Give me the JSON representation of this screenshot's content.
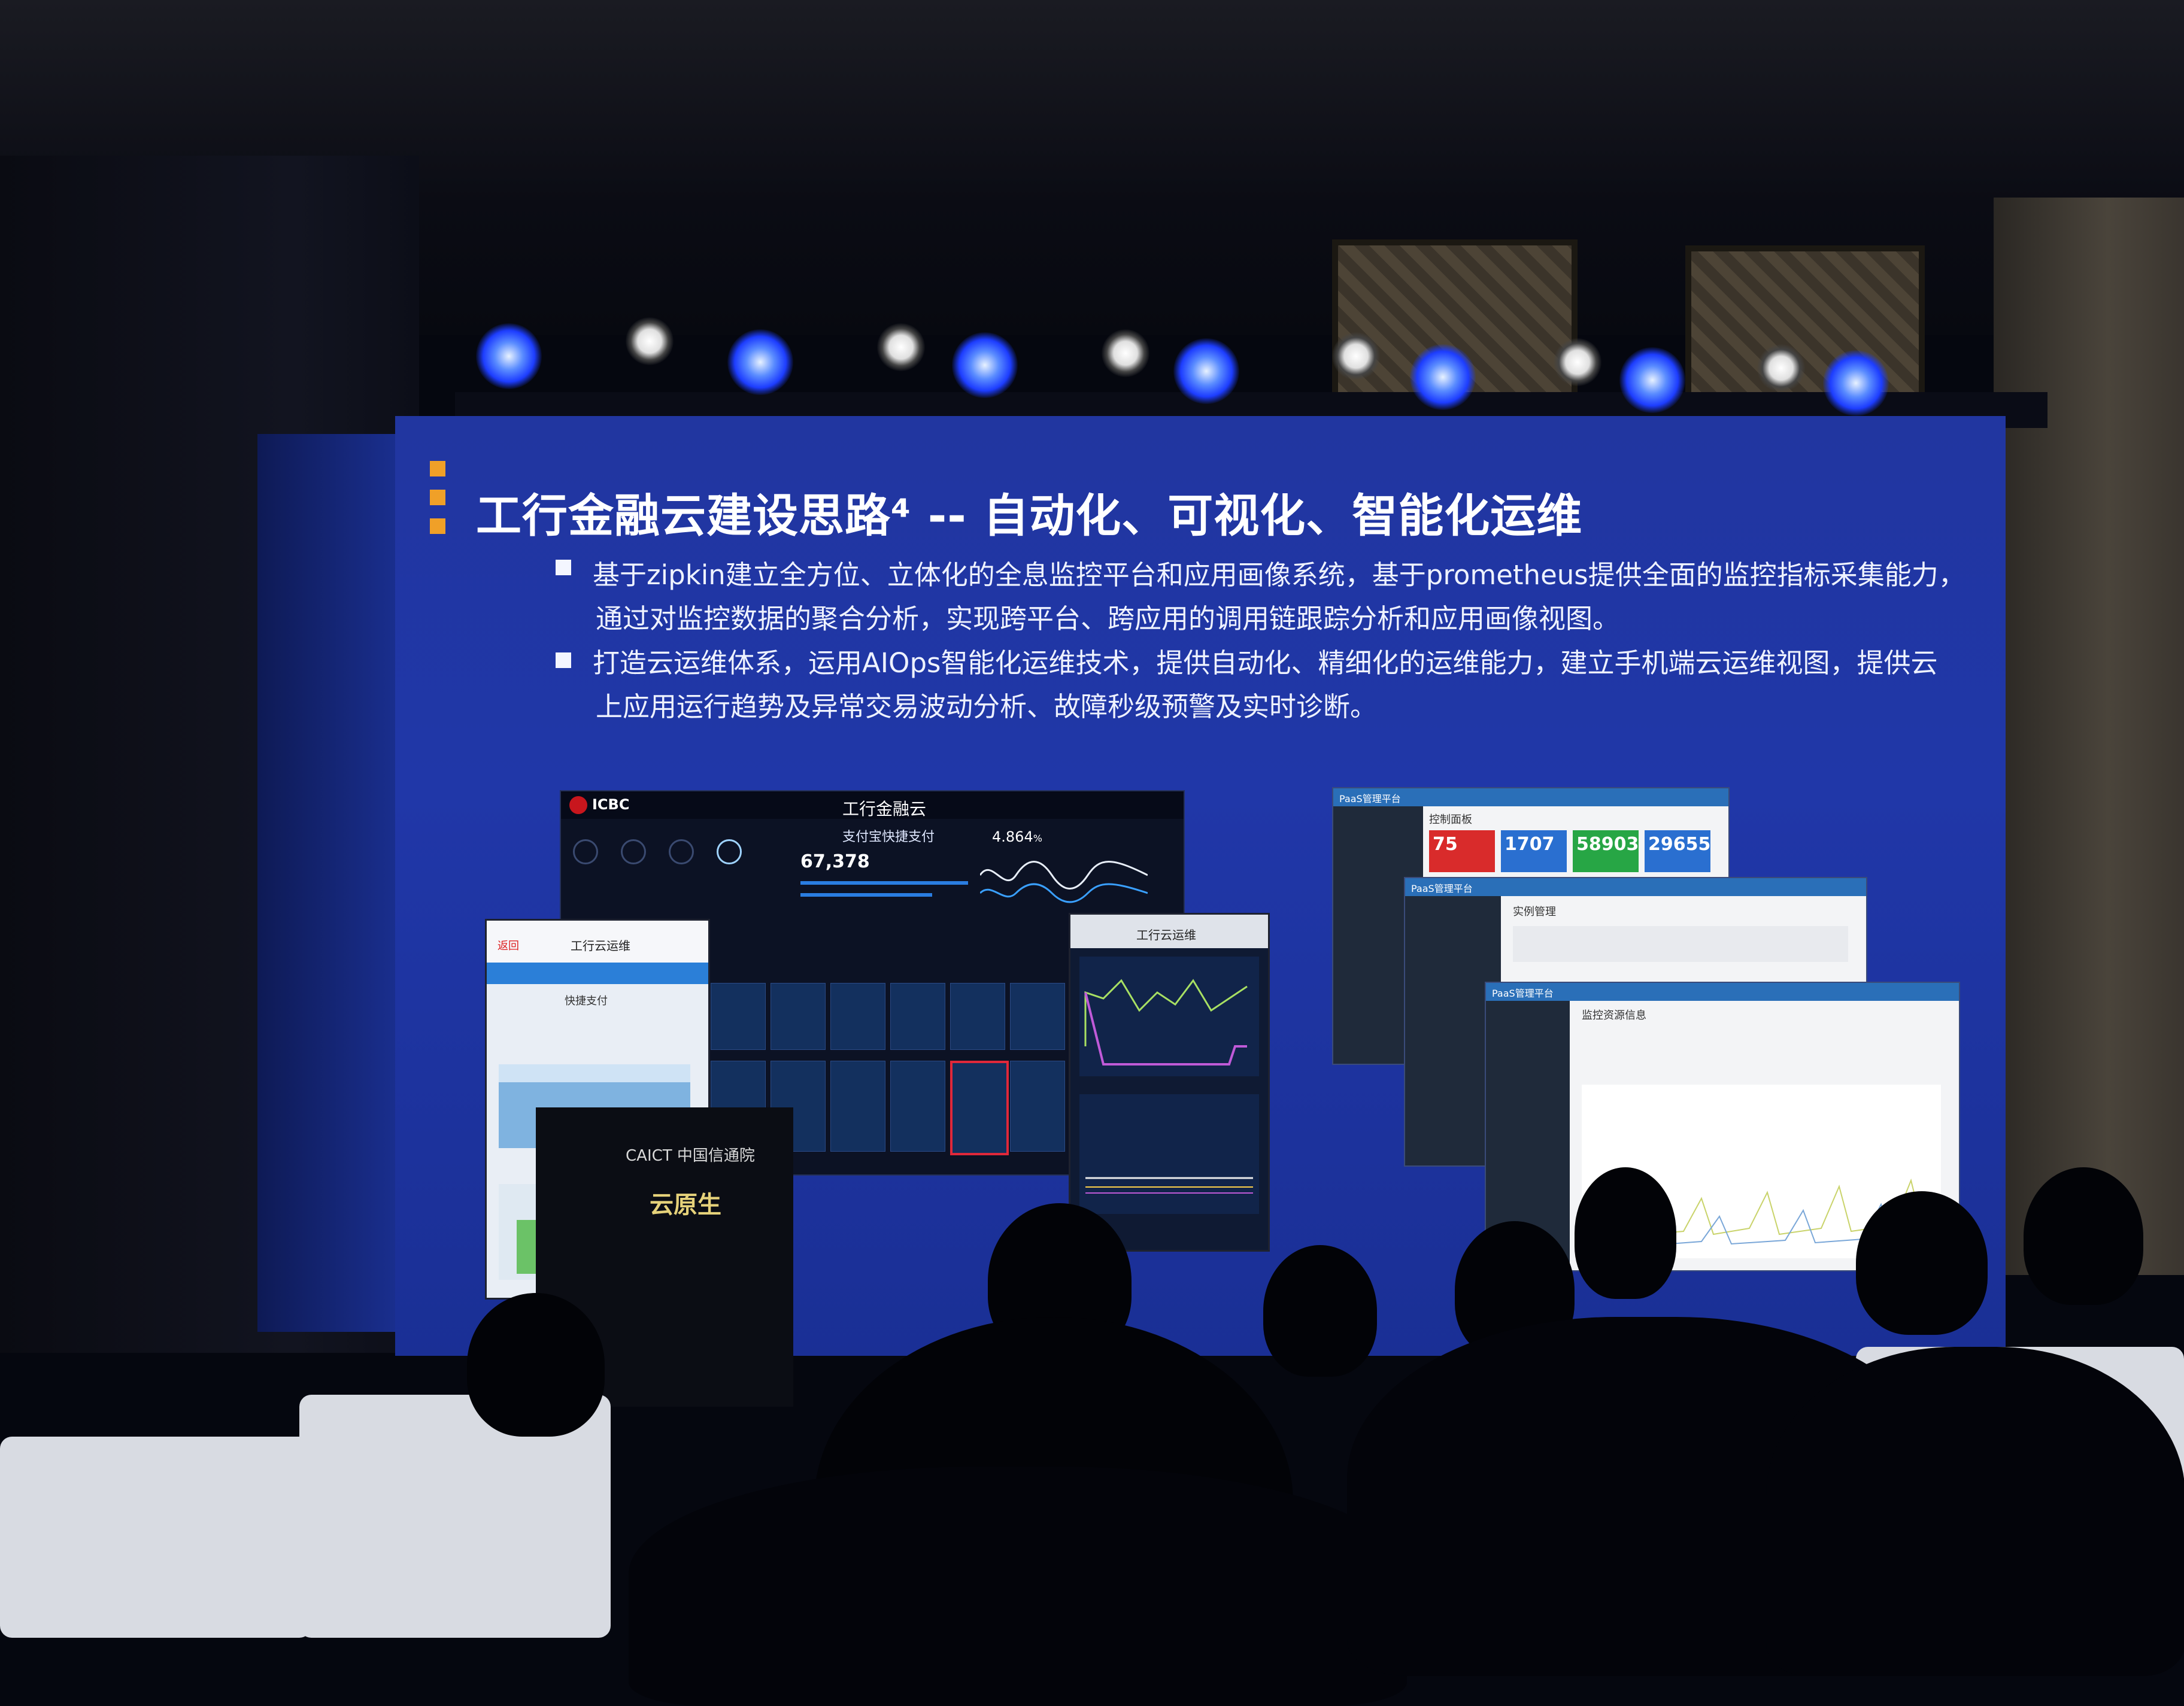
{
  "slide": {
    "title": "工行金融云建设思路⁴ -- 自动化、可视化、智能化运维",
    "bullets": [
      {
        "line1": "基于zipkin建立全方位、立体化的全息监控平台和应用画像系统，基于prometheus提供全面的监控指标采集能力，",
        "line2": "通过对监控数据的聚合分析，实现跨平台、跨应用的调用链跟踪分析和应用画像视图。"
      },
      {
        "line1": "打造云运维体系，运用AIOps智能化运维技术，提供自动化、精细化的运维能力，建立手机端云运维视图，提供云",
        "line2": "上应用运行趋势及异常交易波动分析、故障秒级预警及实时诊断。"
      }
    ]
  },
  "dashboard": {
    "brand": "ICBC",
    "title": "工行金融云",
    "panel_title": "支付宝快捷支付",
    "metric_value": "67,378",
    "metric_pct": "4.864",
    "pct_unit": "%"
  },
  "phone_left": {
    "back_label": "返回",
    "title": "工行云运维",
    "subtitle": "快捷支付"
  },
  "phone_right": {
    "title": "工行云运维"
  },
  "pc_windows": [
    {
      "title": "PaaS管理平台",
      "section": "控制面板",
      "kpis": [
        "75",
        "1707",
        "58903",
        "29655"
      ],
      "kpi_colors": [
        "#d92b2b",
        "#2a6fd0",
        "#27a645",
        "#2a6fd0"
      ]
    },
    {
      "title": "PaaS管理平台",
      "section": "实例管理"
    },
    {
      "title": "PaaS管理平台",
      "section": "监控资源信息"
    }
  ],
  "banner": {
    "top": "CAICT 中国信通院",
    "main": "云原生"
  }
}
